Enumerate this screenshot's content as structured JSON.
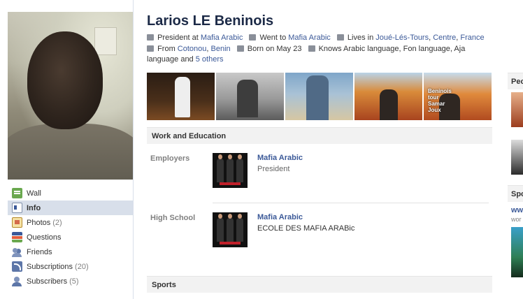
{
  "profile": {
    "name": "Larios LE Beninois",
    "bio": {
      "work_prefix": "President at",
      "work_link": "Mafia Arabic",
      "school_prefix": "Went to",
      "school_link": "Mafia Arabic",
      "lives_prefix": "Lives in",
      "lives_link1": "Joué-Lés-Tours",
      "lives_sep": ",",
      "lives_link2": "Centre",
      "lives_link3": "France",
      "from_prefix": "From",
      "from_link1": "Cotonou",
      "from_link2": "Benin",
      "born": "Born on May 23",
      "knows_prefix": "Knows Arabic language, Fon language, Aja language and",
      "knows_link": "5 others"
    }
  },
  "sidebar": {
    "items": [
      {
        "label": "Wall",
        "count": ""
      },
      {
        "label": "Info",
        "count": ""
      },
      {
        "label": "Photos",
        "count": "(2)"
      },
      {
        "label": "Questions",
        "count": ""
      },
      {
        "label": "Friends",
        "count": ""
      },
      {
        "label": "Subscriptions",
        "count": "(20)"
      },
      {
        "label": "Subscribers",
        "count": "(5)"
      }
    ]
  },
  "photo_strip": {
    "caption5": "Beninois\ntour\nSamar\nJoux"
  },
  "sections": {
    "work": "Work and Education",
    "sports": "Sports"
  },
  "employers": {
    "label": "Employers",
    "name": "Mafia Arabic",
    "role": "President"
  },
  "high_school": {
    "label": "High School",
    "name": "Mafia Arabic",
    "detail": "ECOLE DES MAFIA ARABic"
  },
  "right_column": {
    "head1": "Peo",
    "head2": "Spo",
    "link": "www",
    "sub": "wor"
  }
}
